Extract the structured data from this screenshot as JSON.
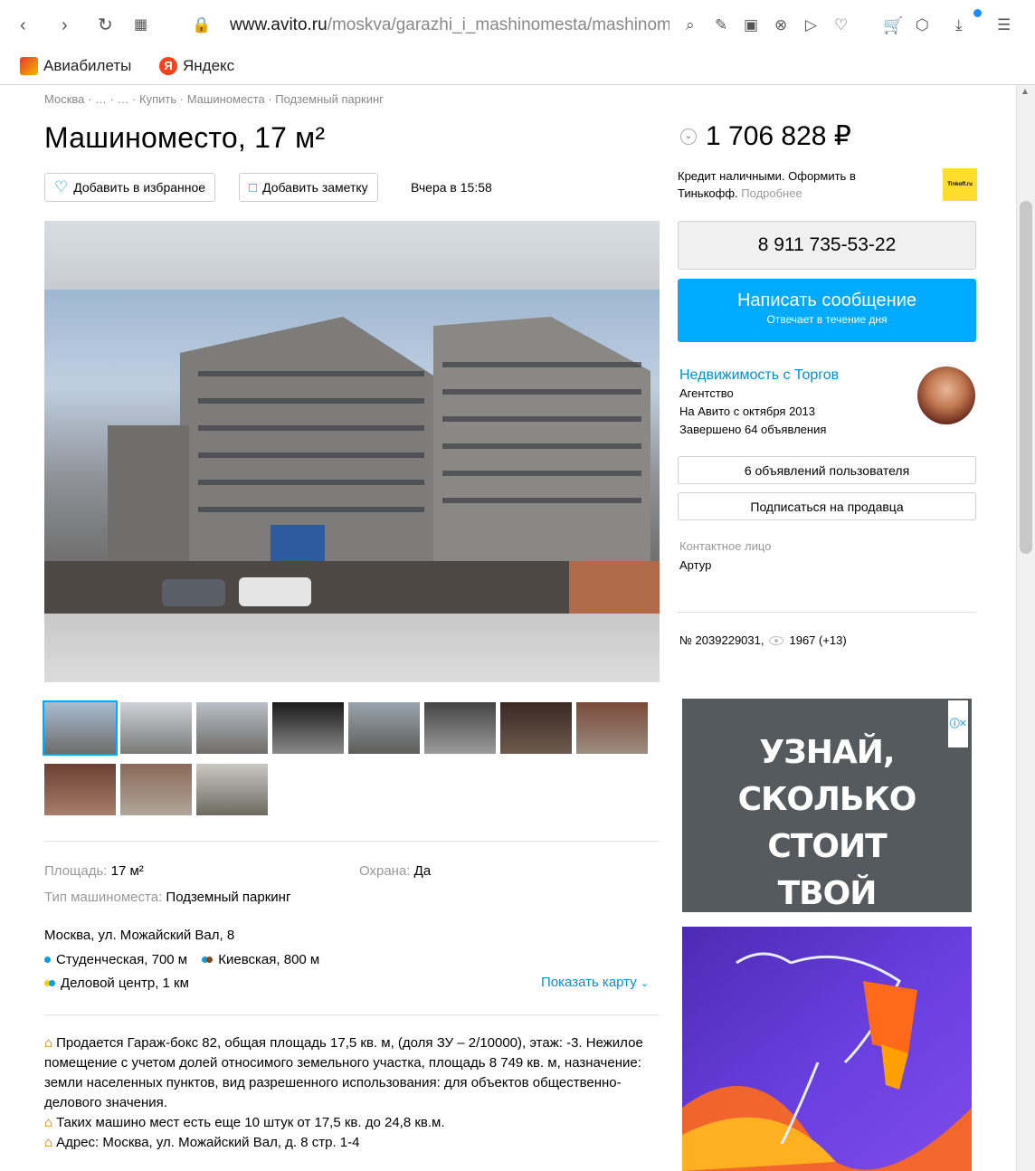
{
  "browser": {
    "url_domain": "www.avito.ru",
    "url_path": "/moskva/garazhi_i_mashinomesta/mashinome",
    "bookmarks": [
      {
        "label": "Авиабилеты",
        "color": "#e53b2c"
      },
      {
        "label": "Яндекс",
        "color": "#fc3f1d"
      }
    ]
  },
  "breadcrumb": "Москва · … · … · Купить · Машиноместа · Подземный паркинг",
  "title": "Машиноместо, 17 м²",
  "actions": {
    "favorite_label": "Добавить в избранное",
    "note_label": "Добавить заметку",
    "date": "Вчера в 15:58"
  },
  "params": {
    "area_key": "Площадь:",
    "area_value": "17 м²",
    "security_key": "Охрана:",
    "security_value": "Да",
    "type_key": "Тип машиноместа:",
    "type_value": "Подземный паркинг"
  },
  "address": {
    "line": "Москва, ул. Можайский Вал, 8",
    "metro": [
      {
        "name": "Студенческая, 700 м",
        "colors": [
          "#00a0e3"
        ]
      },
      {
        "name": "Киевская, 800 м",
        "colors": [
          "#00a0e3",
          "#8b4513"
        ]
      },
      {
        "name": "Деловой центр, 1 км",
        "colors": [
          "#ffd000",
          "#00a0e3"
        ]
      }
    ],
    "show_map": "Показать карту"
  },
  "description": [
    "Продается Гараж-бокс 82, общая площадь 17,5 кв. м, (доля ЗУ – 2/10000), этаж: -3. Нежилое помещение с учетом долей относимого земельного участка, площадь 8 749 кв. м, назначение: земли населенных пунктов, вид разрешенного использования: для объектов общественно-делового значения.",
    "Таких машино мест есть еще 10 штук от 17,5 кв. до 24,8 кв.м.",
    "Адрес: Москва, ул. Можайский Вал, д. 8 стр. 1-4"
  ],
  "price": "1 706 828 ₽",
  "credit": {
    "text": "Кредит наличными. Оформить в Тинькофф.",
    "more": "Подробнее",
    "logo": "Tinkoff.ru"
  },
  "phone": "8 911 735-53-22",
  "message": {
    "label": "Написать сообщение",
    "sub": "Отвечает в течение дня"
  },
  "seller": {
    "name": "Недвижимость с Торгов",
    "type": "Агентство",
    "since": "На Авито с октября 2013",
    "completed": "Завершено 64 объявления",
    "listings_btn": "6 объявлений пользователя",
    "subscribe_btn": "Подписаться на продавца"
  },
  "contact": {
    "key": "Контактное лицо",
    "name": "Артур"
  },
  "ad": {
    "number": "№ 2039229031,",
    "views": "1967 (+13)"
  },
  "banner": {
    "line1": "УЗНАЙ,",
    "line2": "СКОЛЬКО СТОИТ",
    "line3": "ТВОЙ СМАРТФОН"
  }
}
